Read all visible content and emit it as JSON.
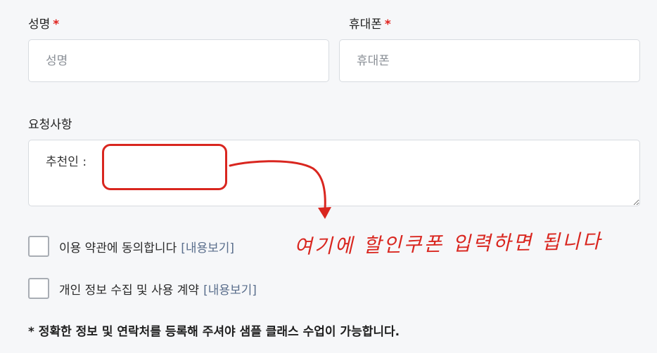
{
  "form": {
    "name": {
      "label": "성명",
      "required_mark": "*",
      "placeholder": "성명"
    },
    "phone": {
      "label": "휴대폰",
      "required_mark": "*",
      "placeholder": "휴대폰"
    },
    "request": {
      "label": "요청사항",
      "value": "추천인 :"
    },
    "terms": {
      "label": "이용 약관에 동의합니다",
      "link": "[내용보기]"
    },
    "privacy": {
      "label": "개인 정보 수집 및 사용 계약",
      "link": "[내용보기]"
    },
    "notice": "* 정확한 정보 및 연락처를 등록해 주셔야 샘플 클래스 수업이 가능합니다."
  },
  "annotation": {
    "text": "여기에 할인쿠폰 입력하면 됩니다",
    "color": "#d9261f"
  }
}
